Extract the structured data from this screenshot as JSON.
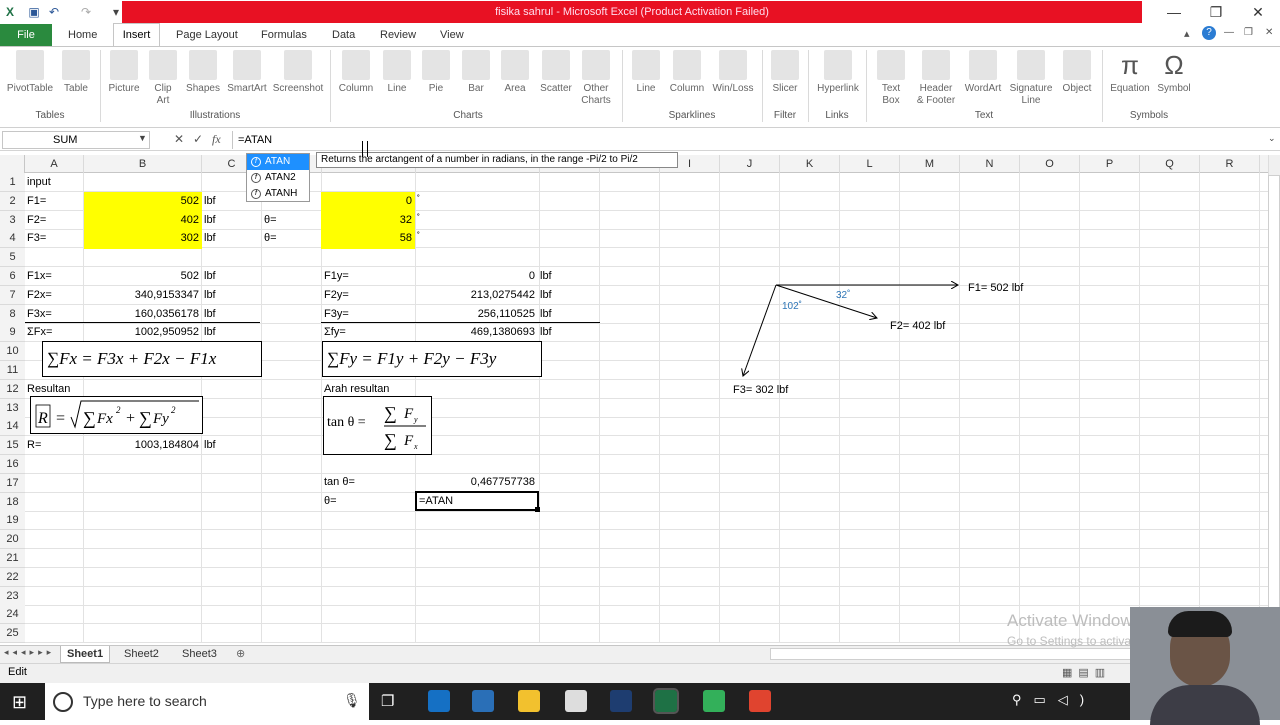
{
  "window": {
    "title": "fisika sahrul  -  Microsoft Excel (Product Activation Failed)"
  },
  "ribbon_tabs": [
    "File",
    "Home",
    "Insert",
    "Page Layout",
    "Formulas",
    "Data",
    "Review",
    "View"
  ],
  "ribbon": {
    "buttons": {
      "pivottable": "PivotTable",
      "table": "Table",
      "picture": "Picture",
      "clipart1": "Clip",
      "clipart2": "Art",
      "shapes": "Shapes",
      "smartart": "SmartArt",
      "screenshot": "Screenshot",
      "column": "Column",
      "line": "Line",
      "pie": "Pie",
      "bar": "Bar",
      "area": "Area",
      "scatter": "Scatter",
      "other1": "Other",
      "other2": "Charts",
      "sp_line": "Line",
      "sp_column": "Column",
      "sp_winloss": "Win/Loss",
      "slicer": "Slicer",
      "hyperlink": "Hyperlink",
      "textbox1": "Text",
      "textbox2": "Box",
      "header1": "Header",
      "header2": "& Footer",
      "wordart": "WordArt",
      "sig1": "Signature",
      "sig2": "Line",
      "object": "Object",
      "equation": "Equation",
      "symbol": "Symbol"
    },
    "groups": {
      "tables": "Tables",
      "illustrations": "Illustrations",
      "charts": "Charts",
      "sparklines": "Sparklines",
      "filter": "Filter",
      "links": "Links",
      "text": "Text",
      "symbols": "Symbols"
    }
  },
  "formula_bar": {
    "name_box": "SUM",
    "formula": "=ATAN"
  },
  "autocomplete": {
    "items": [
      "ATAN",
      "ATAN2",
      "ATANH"
    ],
    "tooltip": "Returns the arctangent of a number in radians, in the range -Pi/2 to Pi/2"
  },
  "columns": [
    "A",
    "B",
    "C",
    "D",
    "E",
    "F",
    "G",
    "H",
    "I",
    "J",
    "K",
    "L",
    "M",
    "N",
    "O",
    "P",
    "Q",
    "R"
  ],
  "rows": [
    "1",
    "2",
    "3",
    "4",
    "5",
    "6",
    "7",
    "8",
    "9",
    "10",
    "11",
    "12",
    "13",
    "14",
    "15",
    "16",
    "17",
    "18",
    "19",
    "20",
    "21",
    "22",
    "23",
    "24",
    "25"
  ],
  "cells": {
    "A1": "input",
    "A2": "F1=",
    "B2": "502",
    "C2": "lbf",
    "E2": "0",
    "A3": "F2=",
    "B3": "402",
    "C3": "lbf",
    "D3": "θ=",
    "E3": "32",
    "A4": "F3=",
    "B4": "302",
    "C4": "lbf",
    "D4": "θ=",
    "E4": "58",
    "deg": "˚",
    "A6": "F1x=",
    "B6": "502",
    "C6": "lbf",
    "D6": "F1y=",
    "E6": "0",
    "F6": "lbf",
    "A7": "F2x=",
    "B7": "340,9153347",
    "C7": "lbf",
    "D7": "F2y=",
    "E7": "213,0275442",
    "F7": "lbf",
    "A8": "F3x=",
    "B8": "160,0356178",
    "C8": "lbf",
    "D8": "F3y=",
    "E8": "256,110525",
    "F8": "lbf",
    "A9": "ΣFx=",
    "B9": "1002,950952",
    "C9": "lbf",
    "D9": "Σfy=",
    "E9": "469,1380693",
    "F9": "lbf",
    "A12": "Resultan",
    "D12": "Arah resultan",
    "A15": "R=",
    "B15": "1003,184804",
    "C15": "lbf",
    "D17": "tan θ=",
    "E17": "0,467757738",
    "D18": "θ=",
    "E18": "=ATAN"
  },
  "equations": {
    "sumfx": "∑Fx = F3x + F2x − F1x",
    "sumfy": "∑Fy = F1y + F2y − F3y",
    "tan_lhs": "tan θ ="
  },
  "diagram": {
    "f1": "F1= 502 lbf",
    "f2": "F2= 402 lbf",
    "f3": "F3= 302 lbf",
    "ang1": "32˚",
    "ang2": "102˚"
  },
  "sheets": [
    "Sheet1",
    "Sheet2",
    "Sheet3"
  ],
  "status": "Edit",
  "watermark": {
    "line1": "Activate Windows",
    "line2": "Go to Settings to activate Windows."
  },
  "taskbar": {
    "search_placeholder": "Type here to search"
  }
}
